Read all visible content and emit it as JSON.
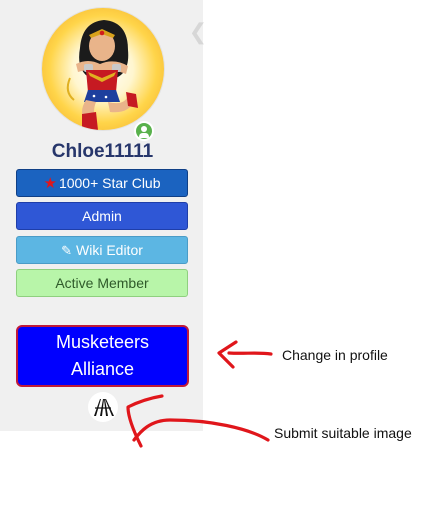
{
  "profile": {
    "username": "Chloe11111",
    "badges": {
      "star_club": "1000+ Star Club",
      "admin": "Admin",
      "wiki_editor": "Wiki Editor",
      "active_member": "Active Member"
    },
    "alliance": {
      "line1": "Musketeers",
      "line2": "Alliance"
    }
  },
  "annotations": {
    "change_profile": "Change in profile",
    "submit_image": "Submit suitable image"
  },
  "colors": {
    "username": "#27366b",
    "star_club": "#1b63c0",
    "admin": "#2f57d6",
    "wiki_editor": "#5cb6e3",
    "active_member": "#b8f5a9",
    "alliance_bg": "#0000ff",
    "alliance_border": "#c01a3a",
    "annotation_stroke": "#e0161b",
    "online": "#59b14c"
  },
  "icons": {
    "avatar": "wonder-woman-avatar",
    "online": "user-online-icon",
    "star": "star-icon",
    "pencil": "pencil-icon",
    "logo": "alliance-logo-icon",
    "collapse": "chevron-left-icon"
  }
}
